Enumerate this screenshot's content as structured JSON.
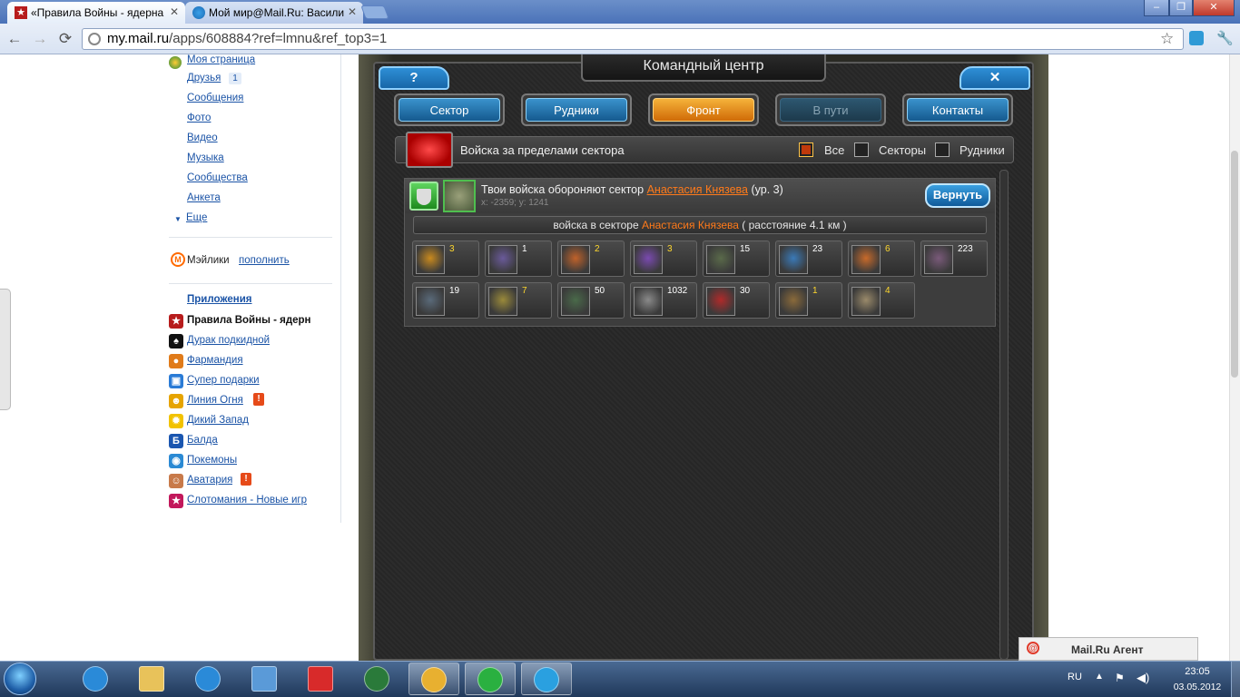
{
  "browser": {
    "tabs": [
      {
        "title": "«Правила Войны - ядерна",
        "active": true
      },
      {
        "title": "Мой мир@Mail.Ru: Васили",
        "active": false
      }
    ],
    "url_host": "my.mail.ru",
    "url_path": "/apps/608884?ref=lmnu&ref_top3=1",
    "window_controls": {
      "minimize": "–",
      "maximize": "❐",
      "close": "✕"
    },
    "nav": {
      "back": "←",
      "forward": "→",
      "reload": "⟳",
      "star": "☆",
      "wrench": "🔧"
    }
  },
  "sidebar": {
    "profile_links": [
      "Моя страница",
      "Друзья",
      "Сообщения",
      "Фото",
      "Видео",
      "Музыка",
      "Сообщества",
      "Анкета",
      "Еще"
    ],
    "friends_badge": "1",
    "mailiki_label": "Мэйлики",
    "mailiki_link": "пополнить",
    "apps_header": "Приложения",
    "apps": [
      {
        "label": "Правила Войны - ядерн",
        "current": true,
        "badge": false,
        "color": "#b71c1c",
        "glyph": "★"
      },
      {
        "label": "Дурак подкидной",
        "current": false,
        "badge": false,
        "color": "#111111",
        "glyph": "♠"
      },
      {
        "label": "Фармандия",
        "current": false,
        "badge": false,
        "color": "#e07b1a",
        "glyph": "●"
      },
      {
        "label": "Супер подарки",
        "current": false,
        "badge": false,
        "color": "#2a7bd6",
        "glyph": "▣"
      },
      {
        "label": "Линия Огня",
        "current": false,
        "badge": true,
        "color": "#e6a400",
        "glyph": "☻"
      },
      {
        "label": "Дикий Запад",
        "current": false,
        "badge": false,
        "color": "#f2c200",
        "glyph": "✹"
      },
      {
        "label": "Балда",
        "current": false,
        "badge": false,
        "color": "#1a56b0",
        "glyph": "Б"
      },
      {
        "label": "Покемоны",
        "current": false,
        "badge": false,
        "color": "#2b8ad4",
        "glyph": "◉"
      },
      {
        "label": "Аватария",
        "current": false,
        "badge": true,
        "color": "#c87a4a",
        "glyph": "☺"
      },
      {
        "label": "Слотомания - Новые игр",
        "current": false,
        "badge": false,
        "color": "#c2185b",
        "glyph": "★"
      }
    ],
    "badge_glyph": "!"
  },
  "game": {
    "title": "Командный центр",
    "help": "?",
    "close": "✕",
    "tabs": [
      {
        "label": "Сектор",
        "state": "normal"
      },
      {
        "label": "Рудники",
        "state": "normal"
      },
      {
        "label": "Фронт",
        "state": "active"
      },
      {
        "label": "В пути",
        "state": "disabled"
      },
      {
        "label": "Контакты",
        "state": "normal"
      }
    ],
    "filter": {
      "title": "Войска за пределами сектора",
      "options": [
        {
          "label": "Все",
          "checked": true
        },
        {
          "label": "Секторы",
          "checked": false
        },
        {
          "label": "Рудники",
          "checked": false
        }
      ]
    },
    "entry": {
      "text": "Твои войска обороняют сектор",
      "owner": "Анастасия Князева",
      "level": "(ур. 3)",
      "coords": "x: -2359; y: 1241",
      "return_button": "Вернуть",
      "sub_prefix": "войска в секторе",
      "sub_owner": "Анастасия Князева",
      "distance": "( расстояние 4.1 км )"
    },
    "units": [
      {
        "count": "3",
        "gold": true,
        "hue": "#c98a1e"
      },
      {
        "count": "1",
        "gold": false,
        "hue": "#6a5a9a"
      },
      {
        "count": "2",
        "gold": true,
        "hue": "#c0622a"
      },
      {
        "count": "3",
        "gold": true,
        "hue": "#7a4ab0"
      },
      {
        "count": "15",
        "gold": false,
        "hue": "#5a6a4a"
      },
      {
        "count": "23",
        "gold": false,
        "hue": "#3a7ab8"
      },
      {
        "count": "6",
        "gold": true,
        "hue": "#c86a2a"
      },
      {
        "count": "223",
        "gold": false,
        "hue": "#7a5a7a"
      },
      {
        "count": "19",
        "gold": false,
        "hue": "#5a6a7a"
      },
      {
        "count": "7",
        "gold": true,
        "hue": "#9a8a3a"
      },
      {
        "count": "50",
        "gold": false,
        "hue": "#4a6a4a"
      },
      {
        "count": "1032",
        "gold": false,
        "hue": "#8a8a8a"
      },
      {
        "count": "30",
        "gold": false,
        "hue": "#b02a2a"
      },
      {
        "count": "1",
        "gold": true,
        "hue": "#8a6a3a"
      },
      {
        "count": "4",
        "gold": true,
        "hue": "#9a8a6a"
      }
    ]
  },
  "agent": {
    "label": "Mail.Ru Агент"
  },
  "taskbar": {
    "lang": "RU",
    "time": "23:05",
    "date": "03.05.2012",
    "apps": [
      "ie",
      "explorer",
      "quicktime",
      "mail",
      "yandex",
      "taskmgr",
      "chrome",
      "mail-agent",
      "skype"
    ]
  }
}
